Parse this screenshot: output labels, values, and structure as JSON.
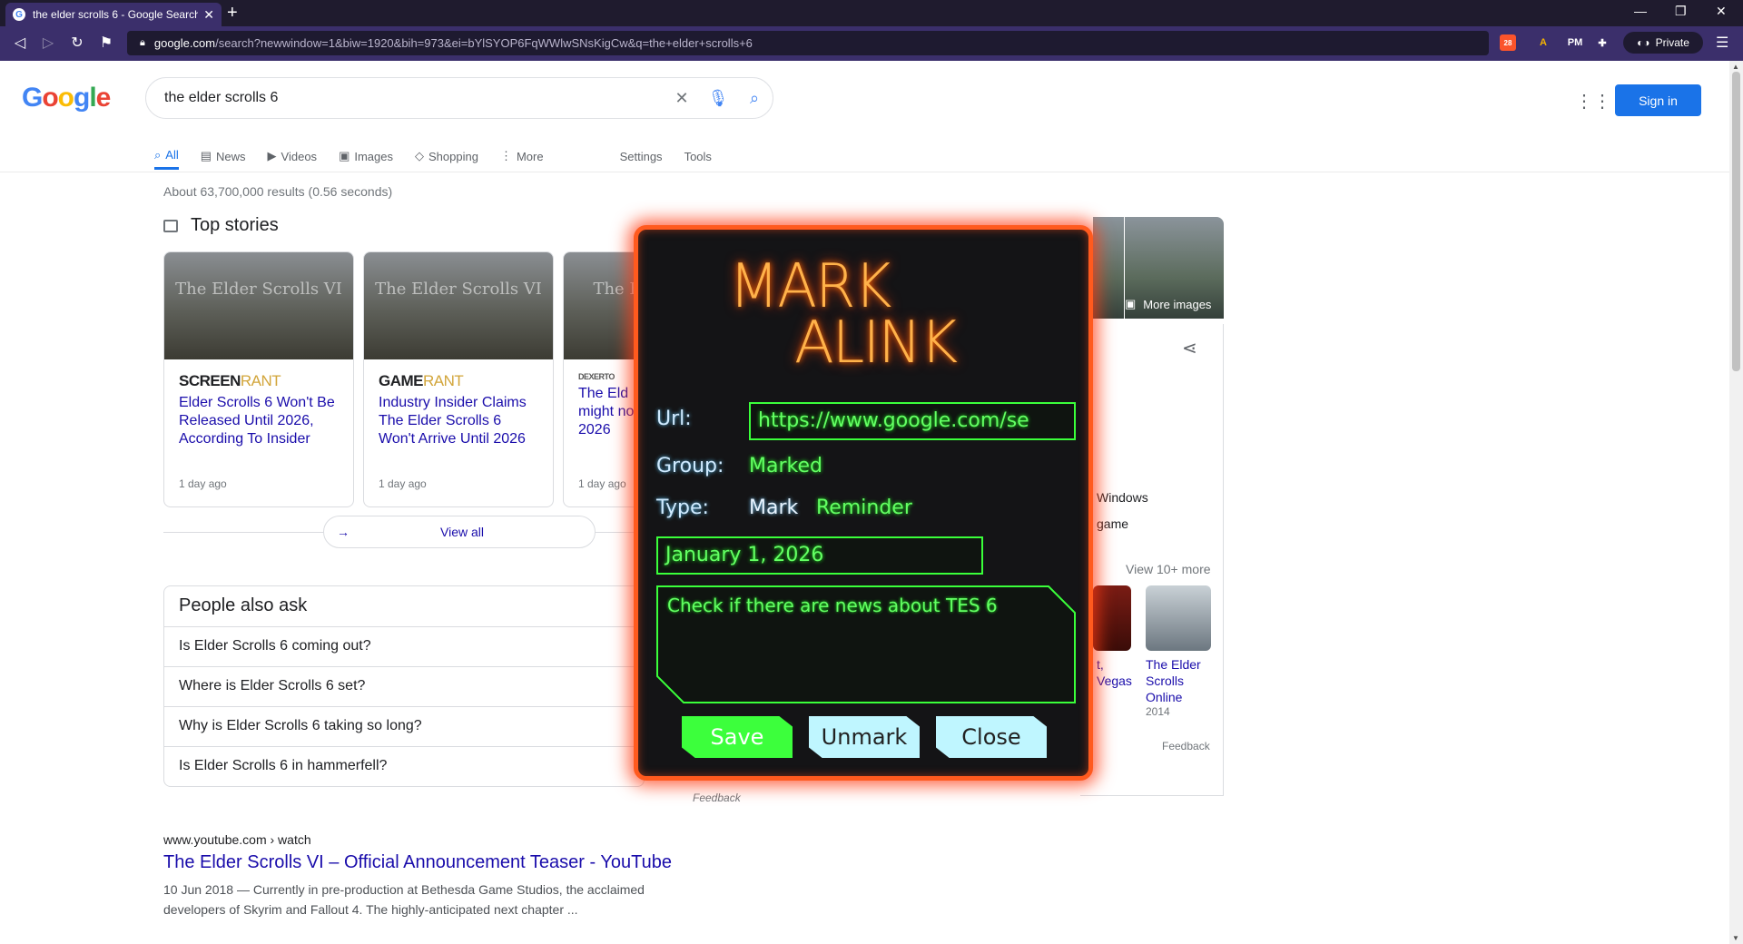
{
  "browser": {
    "tab_title": "the elder scrolls 6 - Google Search",
    "url_host": "google.com",
    "url_path": "/search?newwindow=1&biw=1920&bih=973&ei=bYlSYOP6FqWWlwSNsKigCw&q=the+elder+scrolls+6",
    "private_label": "Private",
    "brave_badge": "28"
  },
  "google": {
    "search_query": "the elder scrolls 6",
    "signin_label": "Sign in",
    "tabs": [
      {
        "label": "All"
      },
      {
        "label": "News"
      },
      {
        "label": "Videos"
      },
      {
        "label": "Images"
      },
      {
        "label": "Shopping"
      },
      {
        "label": "More"
      }
    ],
    "settings_label": "Settings",
    "tools_label": "Tools",
    "result_stats": "About 63,700,000 results (0.56 seconds)",
    "top_stories_title": "Top stories",
    "stories": [
      {
        "img_text": "The Elder Scrolls VI",
        "source_main": "SCREEN",
        "source_accent": "RANT",
        "title": "Elder Scrolls 6 Won't Be Released Until 2026, According To Insider",
        "time": "1 day ago"
      },
      {
        "img_text": "The Elder Scrolls VI",
        "source_main": "GAME",
        "source_accent": "RANT",
        "title": "Industry Insider Claims The Elder Scrolls 6 Won't Arrive Until 2026",
        "time": "1 day ago"
      },
      {
        "img_text": "The E",
        "source_main": "DEXERTO",
        "source_accent": "",
        "title": "The Eld might no 2026",
        "time": "1 day ago"
      }
    ],
    "view_all_label": "View all",
    "paa_title": "People also ask",
    "paa_questions": [
      "Is Elder Scrolls 6 coming out?",
      "Where is Elder Scrolls 6 set?",
      "Why is Elder Scrolls 6 taking so long?",
      "Is Elder Scrolls 6 in hammerfell?"
    ],
    "feedback_label": "Feedback",
    "result": {
      "cite": "www.youtube.com › watch",
      "title": "The Elder Scrolls VI – Official Announcement Teaser - YouTube",
      "snippet": "10 Jun 2018 — Currently in pre-production at Bethesda Game Studios, the acclaimed developers of Skyrim and Fallout 4. The highly-anticipated next chapter ..."
    },
    "knowledge_panel": {
      "more_images_label": "More images",
      "frag_windows": "Windows",
      "frag_game": "game",
      "view_more_label": "View 10+ more",
      "frag_vegas_1": "t,",
      "frag_vegas_2": "Vegas",
      "related_title": "The Elder Scrolls Online",
      "related_year": "2014",
      "feedback_label": "Feedback"
    }
  },
  "popup": {
    "logo_line1": "MARK",
    "logo_line2": "ALINK",
    "url_label": "Url:",
    "url_value": "https://www.google.com/se",
    "group_label": "Group:",
    "group_value": "Marked",
    "type_label": "Type:",
    "type_mark": "Mark",
    "type_reminder": "Reminder",
    "date_value": "January 1, 2026",
    "note_value": "Check if there are news about TES 6",
    "save_label": "Save",
    "unmark_label": "Unmark",
    "close_label": "Close"
  }
}
